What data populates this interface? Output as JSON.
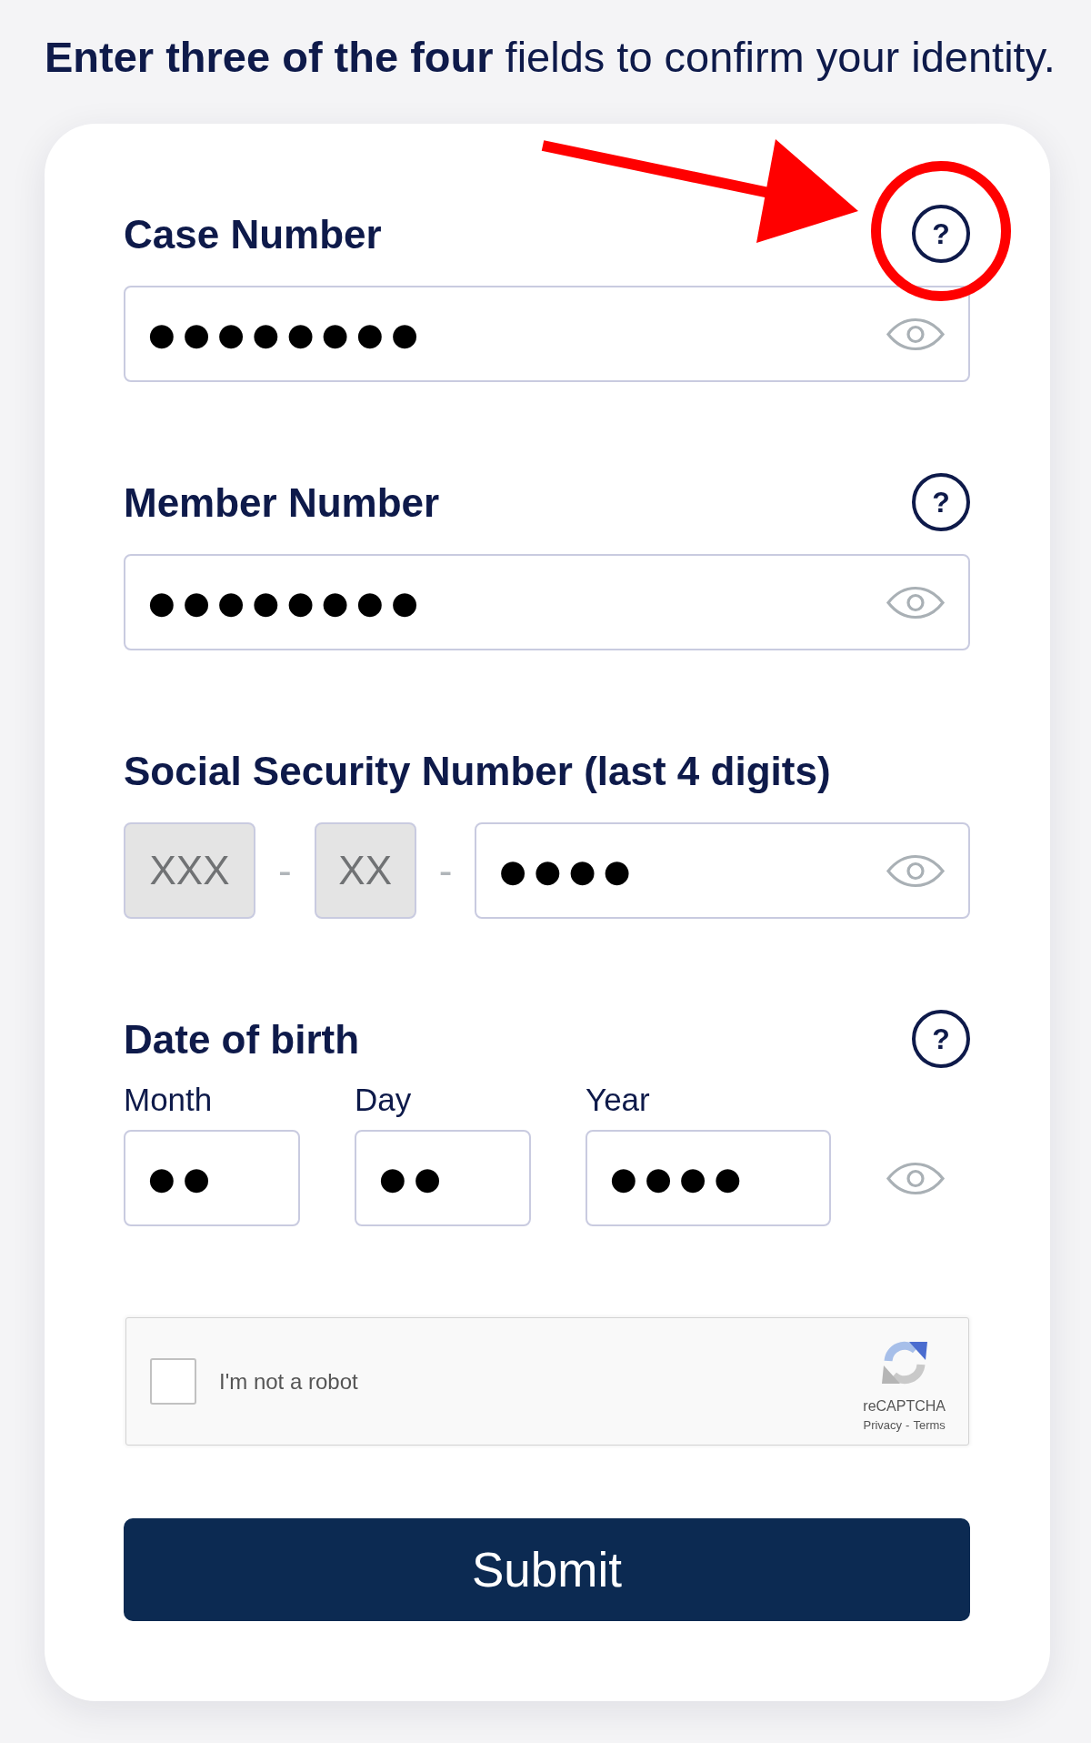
{
  "instruction": "**Enter three of the four** fields to confirm your identity.",
  "fields": [
    {
      "kind": "single",
      "label": "Case Number",
      "help": "?",
      "annotated": true,
      "value": "●●●●●●●●",
      "visibility_toggle": true
    },
    {
      "kind": "single",
      "label": "Member Number",
      "help": "?",
      "annotated": false,
      "value": "●●●●●●●●",
      "visibility_toggle": true
    },
    {
      "kind": "ssn",
      "label": "Social Security Number (last 4 digits)",
      "parts": [
        {
          "kind": "input",
          "placeholder": "XXX",
          "disabled": true
        },
        {
          "kind": "separator",
          "text": "-"
        },
        {
          "kind": "input",
          "placeholder": "XX",
          "disabled": true
        },
        {
          "kind": "separator",
          "text": "-"
        },
        {
          "kind": "input",
          "value": "●●●●",
          "disabled": false,
          "visibility_toggle": true
        }
      ]
    },
    {
      "kind": "date",
      "label": "Date of birth",
      "help": "?",
      "annotated": false,
      "parts": [
        {
          "label": "Month",
          "value": "●●"
        },
        {
          "label": "Day",
          "value": "●●"
        },
        {
          "label": "Year",
          "value": "●●●●"
        }
      ],
      "visibility_toggle": true
    }
  ],
  "captcha": {
    "checked": false,
    "label": "I'm not a robot",
    "brand": "reCAPTCHA",
    "links": [
      {
        "text": "Privacy"
      },
      {
        "text": "Terms"
      }
    ],
    "link_separator": "-"
  },
  "submit": {
    "label": "Submit"
  }
}
